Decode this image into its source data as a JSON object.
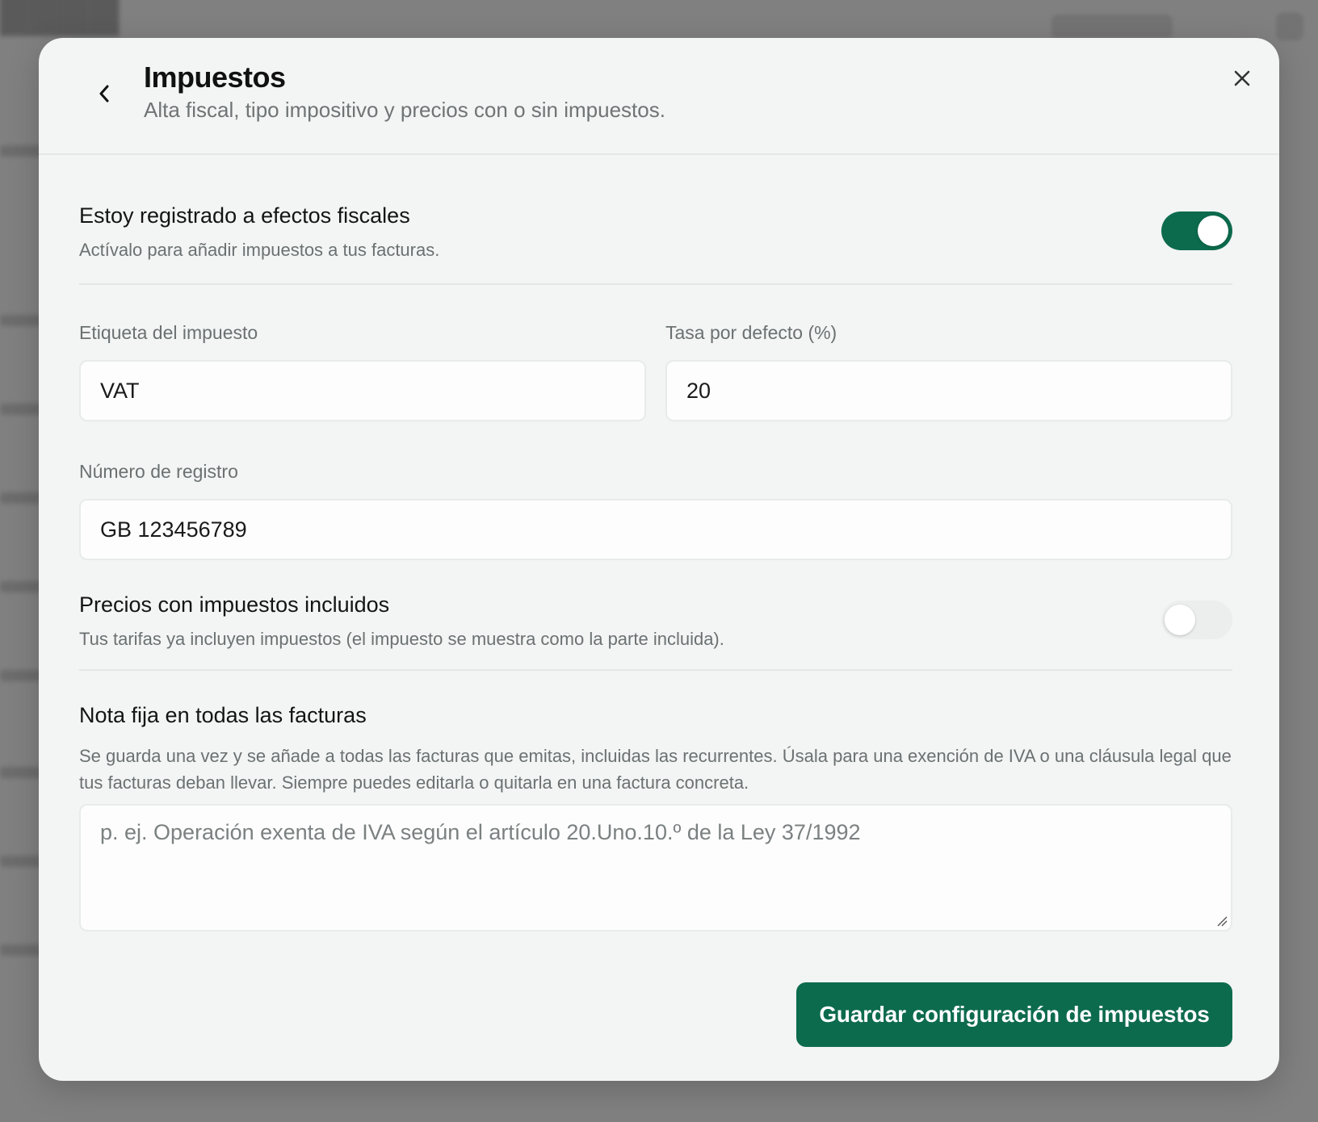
{
  "modal": {
    "title": "Impuestos",
    "subtitle": "Alta fiscal, tipo impositivo y precios con o sin impuestos."
  },
  "tax_registration": {
    "title": "Estoy registrado a efectos fiscales",
    "description": "Actívalo para añadir impuestos a tus facturas.",
    "enabled": true
  },
  "tax_label": {
    "label": "Etiqueta del impuesto",
    "value": "VAT"
  },
  "default_rate": {
    "label": "Tasa por defecto (%)",
    "value": "20"
  },
  "registration_number": {
    "label": "Número de registro",
    "value": "GB 123456789"
  },
  "prices_include_tax": {
    "title": "Precios con impuestos incluidos",
    "description": "Tus tarifas ya incluyen impuestos (el impuesto se muestra como la parte incluida).",
    "enabled": false
  },
  "fixed_note": {
    "title": "Nota fija en todas las facturas",
    "description": "Se guarda una vez y se añade a todas las facturas que emitas, incluidas las recurrentes. Úsala para una exención de IVA o una cláusula legal que tus facturas deban llevar. Siempre puedes editarla o quitarla en una factura concreta.",
    "placeholder": "p. ej. Operación exenta de IVA según el artículo 20.Uno.10.º de la Ley 37/1992",
    "value": ""
  },
  "save_button": {
    "label": "Guardar configuración de impuestos"
  },
  "colors": {
    "accent": "#0d6b4d",
    "modal_bg": "#f3f4f4",
    "overlay": "#7d7d7d"
  },
  "icons": {
    "back": "chevron-left-icon",
    "close": "close-icon"
  }
}
